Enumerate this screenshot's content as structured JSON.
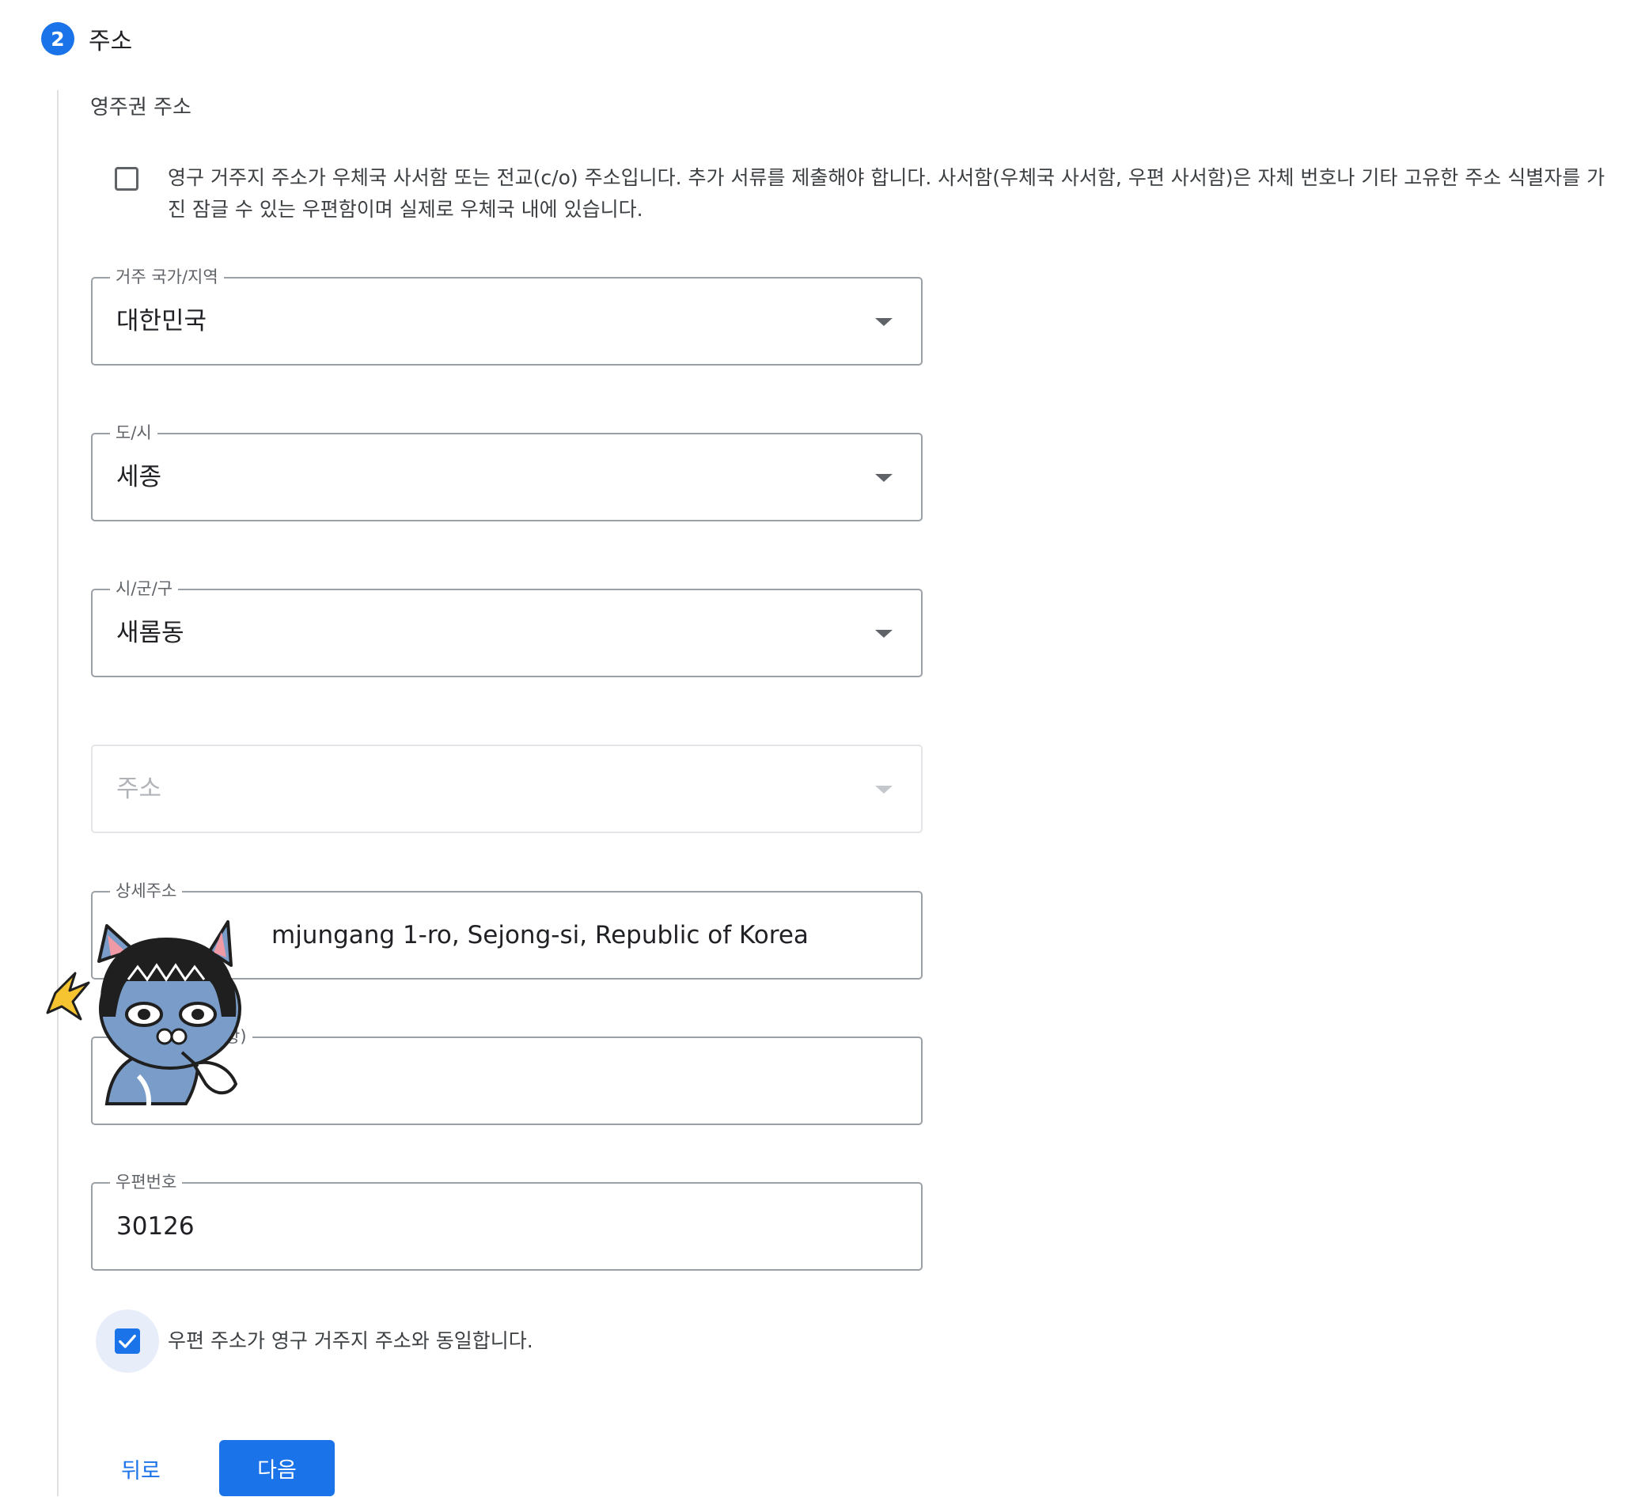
{
  "step": {
    "number": "2",
    "title": "주소"
  },
  "section": {
    "label": "영주권 주소"
  },
  "po_box_checkbox": {
    "checked": false,
    "label": "영구 거주지 주소가 우체국 사서함 또는 전교(c/o) 주소입니다. 추가 서류를 제출해야 합니다. 사서함(우체국 사서함, 우편 사서함)은 자체 번호나 기타 고유한 주소 식별자를 가진 잠글 수 있는 우편함이며 실제로 우체국 내에 있습니다."
  },
  "fields": {
    "country": {
      "label": "거주 국가/지역",
      "value": "대한민국"
    },
    "province": {
      "label": "도/시",
      "value": "세종"
    },
    "district": {
      "label": "시/군/구",
      "value": "새롬동"
    },
    "address": {
      "placeholder": "주소",
      "disabled": true
    },
    "detail": {
      "label": "상세주소",
      "value_visible": "mjungang 1-ro, Sejong-si, Republic of Korea"
    },
    "detail2": {
      "label_visible": "항)",
      "value": ""
    },
    "postal": {
      "label": "우편번호",
      "value": "30126"
    }
  },
  "same_address_checkbox": {
    "checked": true,
    "label": "우편 주소가 영구 거주지 주소와 동일합니다."
  },
  "buttons": {
    "back": "뒤로",
    "next": "다음"
  },
  "colors": {
    "primary": "#1a73e8",
    "border": "#9aa0a6",
    "text": "#202124",
    "muted": "#5f6368",
    "sticker_body": "#7a9cc9",
    "sticker_hair": "#1f1f1f",
    "sticker_spark": "#f6c431"
  },
  "icons": {
    "dropdown": "arrow-drop-down-icon",
    "check": "check-icon",
    "sticker": "cat-character-sticker"
  }
}
